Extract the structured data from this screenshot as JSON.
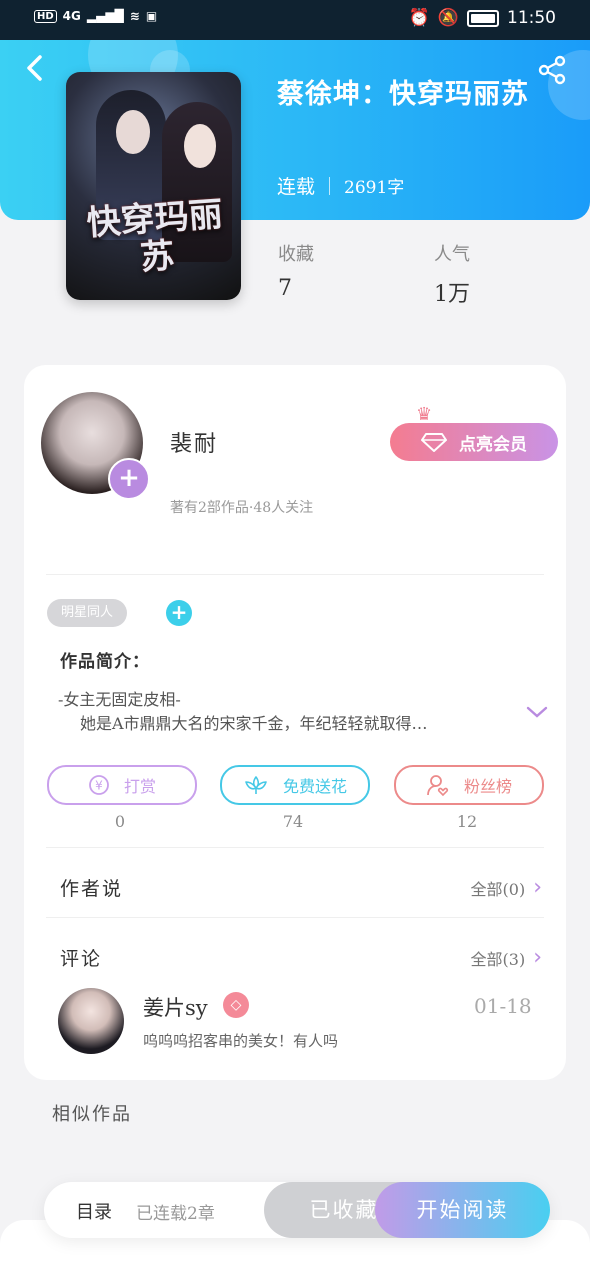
{
  "status_bar": {
    "left_text": "HD",
    "network": "4G",
    "time": "11:50"
  },
  "book": {
    "title": "蔡徐坤：快穿玛丽苏",
    "status": "连载",
    "words": "2691字",
    "cover_text": "快穿玛丽苏",
    "stats": {
      "favorites_label": "收藏",
      "favorites_value": "7",
      "popularity_label": "人气",
      "popularity_value": "1万"
    }
  },
  "author": {
    "name": "裴耐",
    "meta": "著有2部作品·48人关注",
    "vip_label": "点亮会员"
  },
  "tags": [
    "明星同人"
  ],
  "intro": {
    "title": "作品简介：",
    "line1": "-女主无固定皮相-",
    "line2": "她是A市鼎鼎大名的宋家千金，年纪轻轻就取得…"
  },
  "actions": [
    {
      "label": "打赏",
      "count": "0",
      "color": "#c9a0ec",
      "icon": "yen-coin-icon"
    },
    {
      "label": "免费送花",
      "count": "74",
      "color": "#45c8e6",
      "icon": "flower-icon"
    },
    {
      "label": "粉丝榜",
      "count": "12",
      "color": "#ec8a8a",
      "icon": "fan-user-icon"
    }
  ],
  "author_says": {
    "title": "作者说",
    "link": "全部(0)"
  },
  "comments": {
    "title": "评论",
    "link": "全部(3)",
    "items": [
      {
        "user": "姜片sy",
        "date": "01-18",
        "text": "呜呜呜招客串的美女！有人吗"
      }
    ]
  },
  "similar_title": "相似作品",
  "bottom": {
    "toc": "目录",
    "toc_sub": "已连载2章",
    "fav_button": "已收藏",
    "read_button": "开始阅读"
  }
}
